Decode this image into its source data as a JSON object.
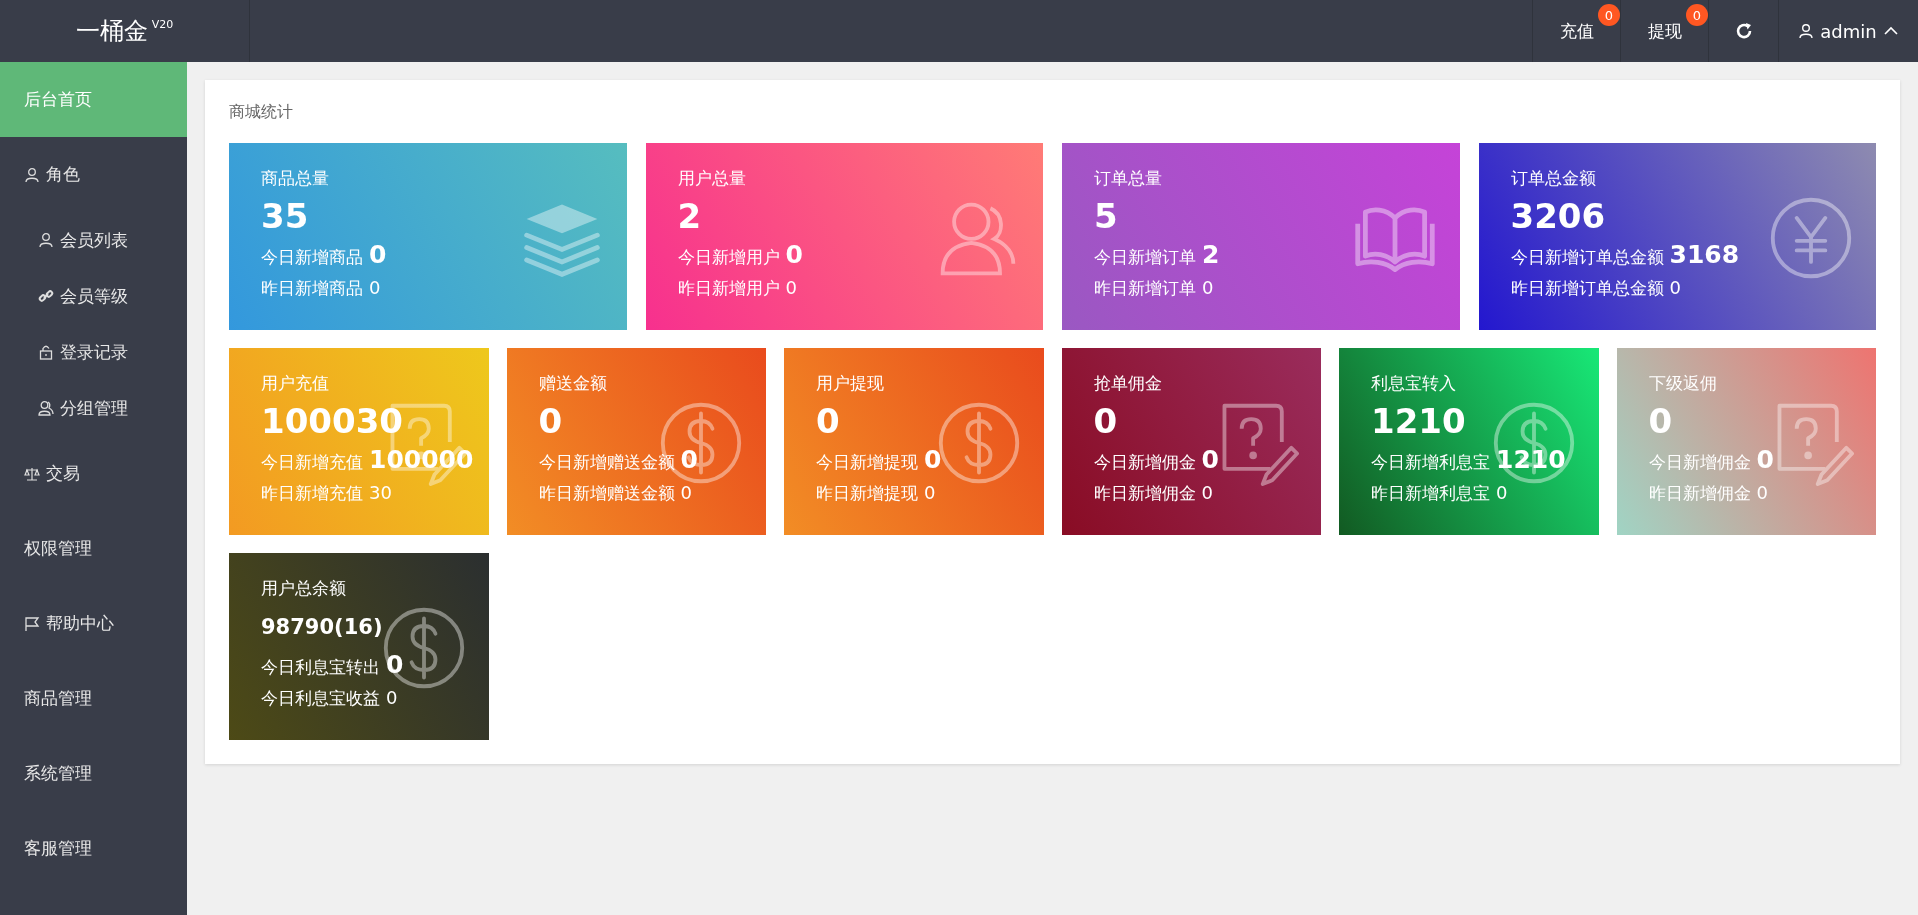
{
  "header": {
    "logo": "一桶金",
    "version": "V20",
    "actions": [
      {
        "label": "充值",
        "badge": "0"
      },
      {
        "label": "提现",
        "badge": "0"
      }
    ],
    "user": "admin"
  },
  "sidebar": {
    "items": [
      {
        "label": "后台首页",
        "selected": true
      },
      {
        "label": "角色",
        "selected": false,
        "children": [
          {
            "label": "会员列表",
            "selected": false
          },
          {
            "label": "会员等级",
            "selected": false
          },
          {
            "label": "登录记录",
            "selected": false
          },
          {
            "label": "分组管理",
            "selected": false
          }
        ]
      },
      {
        "label": "交易",
        "selected": false
      },
      {
        "label": "权限管理",
        "selected": false
      },
      {
        "label": "帮助中心",
        "selected": false
      },
      {
        "label": "商品管理",
        "selected": false
      },
      {
        "label": "系统管理",
        "selected": false
      },
      {
        "label": "客服管理",
        "selected": false
      }
    ]
  },
  "panel": {
    "title": "商城统计",
    "cards": [
      {
        "title": "商品总量",
        "value": "35",
        "today_label": "今日新增商品",
        "today_value": "0",
        "yesterday_label": "昨日新增商品",
        "yesterday_value": "0"
      },
      {
        "title": "用户总量",
        "value": "2",
        "today_label": "今日新增用户",
        "today_value": "0",
        "yesterday_label": "昨日新增用户",
        "yesterday_value": "0"
      },
      {
        "title": "订单总量",
        "value": "5",
        "today_label": "今日新增订单",
        "today_value": "2",
        "yesterday_label": "昨日新增订单",
        "yesterday_value": "0"
      },
      {
        "title": "订单总金额",
        "value": "3206",
        "today_label": "今日新增订单总金额",
        "today_value": "3168",
        "yesterday_label": "昨日新增订单总金额",
        "yesterday_value": "0"
      },
      {
        "title": "用户充值",
        "value": "100030",
        "today_label": "今日新增充值",
        "today_value": "100000",
        "yesterday_label": "昨日新增充值",
        "yesterday_value": "30"
      },
      {
        "title": "赠送金额",
        "value": "0",
        "today_label": "今日新增赠送金额",
        "today_value": "0",
        "yesterday_label": "昨日新增赠送金额",
        "yesterday_value": "0"
      },
      {
        "title": "用户提现",
        "value": "0",
        "today_label": "今日新增提现",
        "today_value": "0",
        "yesterday_label": "昨日新增提现",
        "yesterday_value": "0"
      },
      {
        "title": "抢单佣金",
        "value": "0",
        "today_label": "今日新增佣金",
        "today_value": "0",
        "yesterday_label": "昨日新增佣金",
        "yesterday_value": "0"
      },
      {
        "title": "利息宝转入",
        "value": "1210",
        "today_label": "今日新增利息宝",
        "today_value": "1210",
        "yesterday_label": "昨日新增利息宝",
        "yesterday_value": "0"
      },
      {
        "title": "下级返佣",
        "value": "0",
        "today_label": "今日新增佣金",
        "today_value": "0",
        "yesterday_label": "昨日新增佣金",
        "yesterday_value": "0"
      },
      {
        "title": "用户总余额",
        "value": "98790(16)",
        "today_label": "今日利息宝转出",
        "today_value": "0",
        "yesterday_label": "今日利息宝收益",
        "yesterday_value": "0"
      }
    ]
  }
}
